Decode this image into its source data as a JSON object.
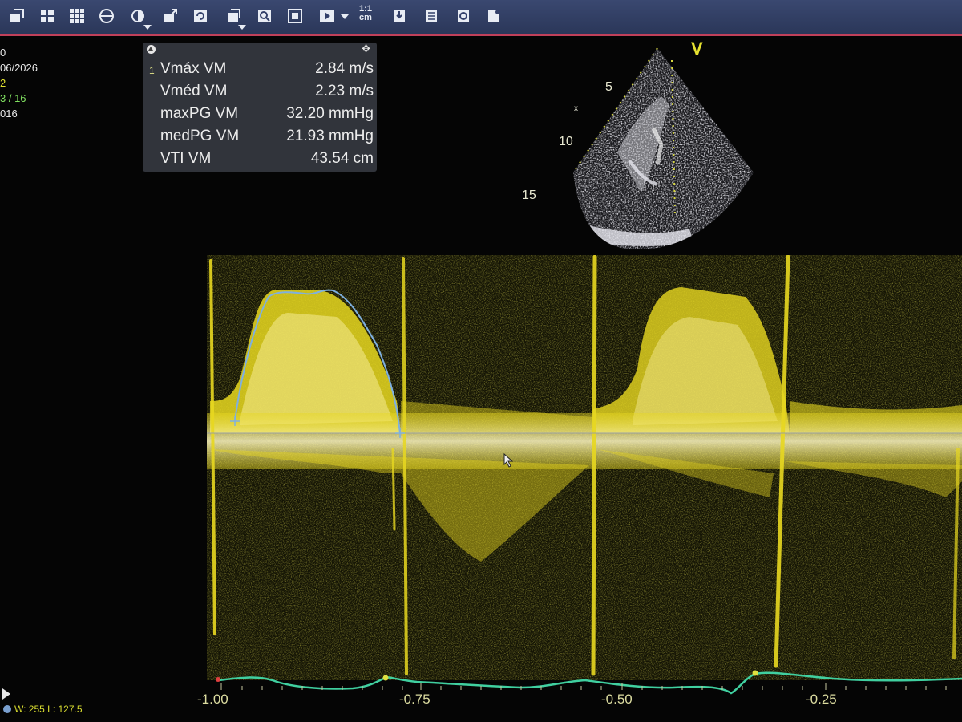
{
  "toolbar": {
    "buttons": [
      "layout-icon",
      "grid-icon",
      "grid-3x3-icon",
      "contrast-circle-icon",
      "display-mode-icon",
      "export-icon",
      "refresh-icon",
      "rotate-icon",
      "zoom-icon",
      "fit-screen-icon",
      "play-icon",
      "scale-icon",
      "marker-icon",
      "report-icon",
      "patient-icon",
      "capture-icon"
    ],
    "scale_top": "1:1",
    "scale_bottom": "cm"
  },
  "side_info": {
    "line1": "0",
    "line2": "06/2026",
    "line3": "2",
    "line4": "3 / 16",
    "line5": "016"
  },
  "measurements": {
    "index": "1",
    "rows": [
      {
        "name": "Vmáx VM",
        "value": "2.84 m/s"
      },
      {
        "name": "Vméd VM",
        "value": "2.23 m/s"
      },
      {
        "name": "maxPG VM",
        "value": "32.20 mmHg"
      },
      {
        "name": "medPG VM",
        "value": "21.93 mmHg"
      },
      {
        "name": "VTI VM",
        "value": "43.54 cm"
      }
    ]
  },
  "echo": {
    "marker": "V",
    "depth_labels": [
      "5",
      "10",
      "15"
    ]
  },
  "time_axis": {
    "ticks": [
      "-1.00",
      "-0.75",
      "-0.50",
      "-0.25"
    ]
  },
  "window_level": "W: 255 L: 127.5",
  "colors": {
    "doppler": "#e8d820",
    "trace": "#7fb0e0",
    "ecg": "#40d0a0",
    "toolbar": "#33406a",
    "accent_red": "#c0405a"
  }
}
